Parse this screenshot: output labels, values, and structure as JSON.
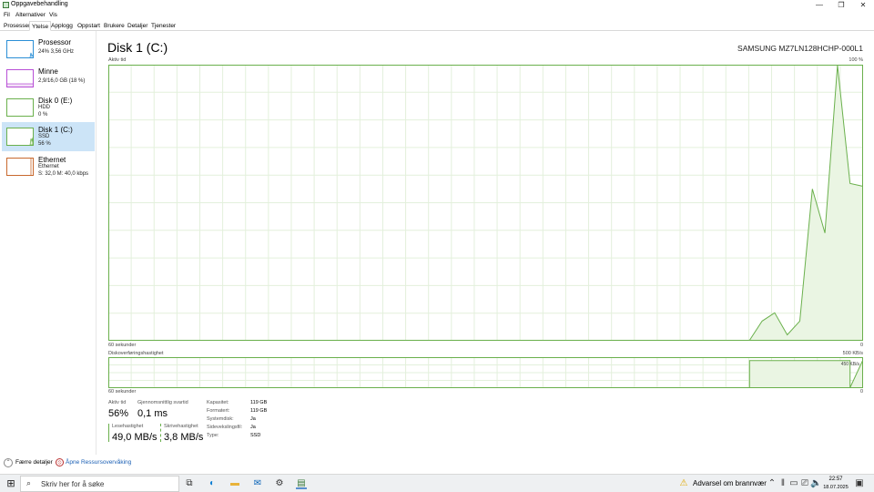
{
  "window": {
    "title": "Oppgavebehandling",
    "minimize": "—",
    "maximize": "❐",
    "close": "✕"
  },
  "menu": [
    "Fil",
    "Alternativer",
    "Vis"
  ],
  "tabs": [
    "Prosesser",
    "Ytelse",
    "Applogg",
    "Oppstart",
    "Brukere",
    "Detaljer",
    "Tjenester"
  ],
  "active_tab": "Ytelse",
  "sidebar": {
    "items": [
      {
        "title": "Prosessor",
        "line1": "24% 3,56 GHz",
        "line2": "",
        "color": "#2b8fd6"
      },
      {
        "title": "Minne",
        "line1": "2,9/16,0 GB (18 %)",
        "line2": "",
        "color": "#b84fd6"
      },
      {
        "title": "Disk 0 (E:)",
        "line1": "HDD",
        "line2": "0 %",
        "color": "#6ab04c"
      },
      {
        "title": "Disk 1 (C:)",
        "line1": "SSD",
        "line2": "56 %",
        "color": "#6ab04c"
      },
      {
        "title": "Ethernet",
        "line1": "Ethernet",
        "line2": "S: 32,0 M: 40,0 kbps",
        "color": "#c8692e"
      }
    ]
  },
  "main": {
    "title": "Disk 1 (C:)",
    "model": "SAMSUNG MZ7LN128HCHP-000L1",
    "chart1": {
      "label": "Aktiv tid",
      "max": "100 %",
      "xlabel": "60 sekunder",
      "min": "0"
    },
    "chart2": {
      "label": "Diskoverføringshastighet",
      "max": "500 KB/s",
      "inner": "450 KB/s",
      "xlabel": "60 sekunder",
      "min": "0"
    },
    "stats": {
      "active_label": "Aktiv tid",
      "active_value": "56%",
      "resp_label": "Gjennomsnittlig svartid",
      "resp_value": "0,1 ms",
      "read_label": "Lesehastighet",
      "read_value": "49,0 MB/s",
      "write_label": "Skrivehastighet",
      "write_value": "3,8 MB/s"
    },
    "props": [
      {
        "label": "Kapasitet:",
        "value": "119 GB"
      },
      {
        "label": "Formatert:",
        "value": "119 GB"
      },
      {
        "label": "Systemdisk:",
        "value": "Ja"
      },
      {
        "label": "Sidevekslingsfil:",
        "value": "Ja"
      },
      {
        "label": "Type:",
        "value": "SSD"
      }
    ]
  },
  "footer": {
    "fewer": "Færre detaljer",
    "resmon": "Åpne Ressursovervåking"
  },
  "taskbar": {
    "search_placeholder": "Skriv her for å søke",
    "alert": "Advarsel om brannvær",
    "time": "22:57",
    "date": "18.07.2025"
  },
  "chart_data": [
    {
      "type": "area",
      "title": "Aktiv tid",
      "x_label": "60 sekunder",
      "ylim": [
        0,
        100
      ],
      "x": [
        -60,
        -52,
        -9,
        -8,
        -7,
        -6,
        -5,
        -4,
        -3,
        -2,
        -1,
        0
      ],
      "values": [
        0,
        0,
        0,
        7,
        10,
        2,
        7,
        55,
        39,
        100,
        57,
        56
      ]
    },
    {
      "type": "area",
      "title": "Diskoverføringshastighet",
      "x_label": "60 sekunder",
      "ylim": [
        0,
        500
      ],
      "x": [
        -60,
        -9,
        -9,
        -1,
        -1,
        0
      ],
      "values": [
        0,
        0,
        450,
        450,
        0,
        450
      ]
    }
  ]
}
